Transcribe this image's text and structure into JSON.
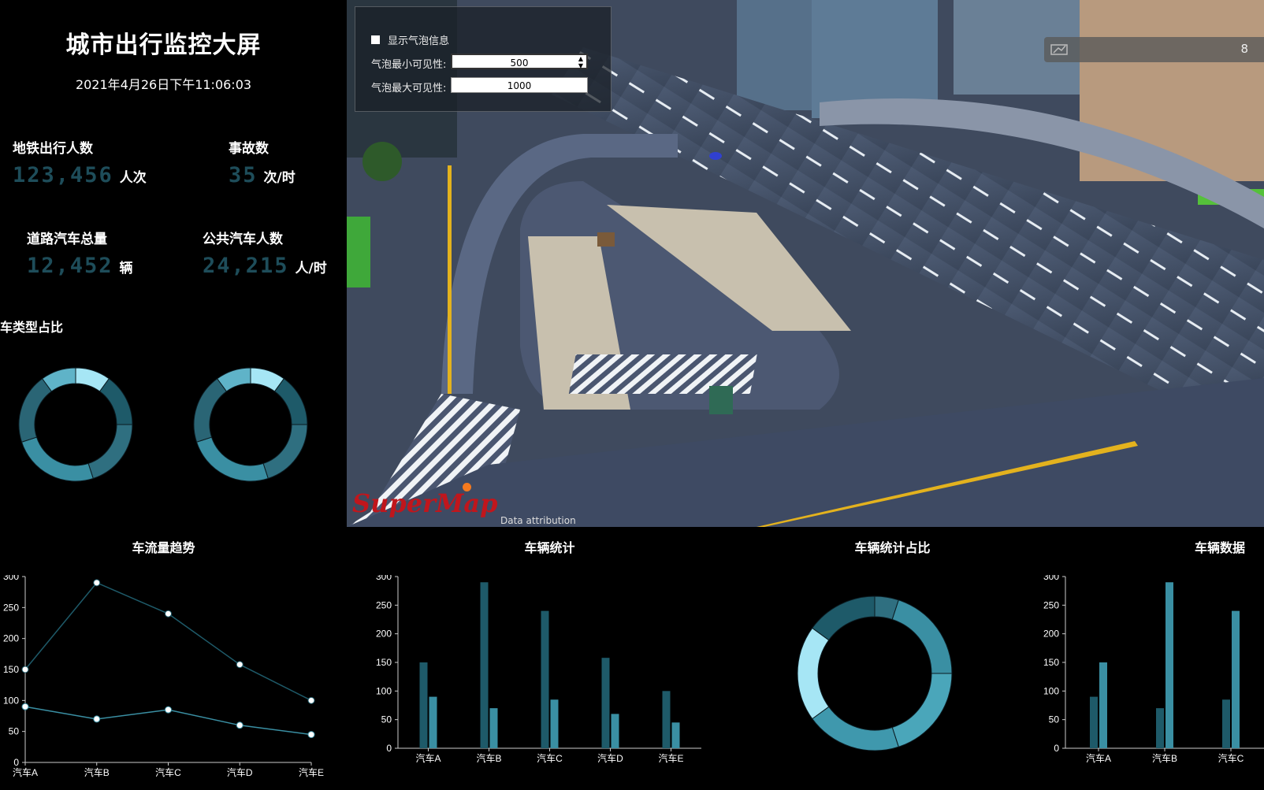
{
  "header": {
    "title": "城市出行监控大屏",
    "datetime": "2021年4月26日下午11:06:03"
  },
  "stats": {
    "subway": {
      "label": "地铁出行人数",
      "value": "123,456",
      "unit": "人次"
    },
    "accident": {
      "label": "事故数",
      "value": "35",
      "unit": "次/时"
    },
    "road": {
      "label": "道路汽车总量",
      "value": "12,452",
      "unit": "辆"
    },
    "bus": {
      "label": "公共汽车人数",
      "value": "24,215",
      "unit": "人/时"
    }
  },
  "vehicle_type": {
    "title": "汽车类型占比"
  },
  "map": {
    "bubble_panel": {
      "checkbox_label": "显示气泡信息",
      "min_label": "气泡最小可见性:",
      "min_value": "500",
      "max_label": "气泡最大可见性:",
      "max_value": "1000"
    },
    "fps_value": "8",
    "logo_text": "SuperMap",
    "attribution": "Data attribution"
  },
  "panels": {
    "trend_title": "车流量趋势",
    "stats_title": "车辆统计",
    "ratio_title": "车辆统计占比",
    "data_title": "车辆数据"
  },
  "colors": {
    "series_dark": "#1e5a69",
    "series_mid": "#3a8fa3",
    "series_light": "#a6e6f5",
    "value_text": "#1e4d5a"
  },
  "chart_data": [
    {
      "type": "line",
      "title": "车流量趋势",
      "categories": [
        "汽车A",
        "汽车B",
        "汽车C",
        "汽车D",
        "汽车E"
      ],
      "ylim": [
        0,
        300
      ],
      "yticks": [
        0,
        50,
        100,
        150,
        200,
        250,
        300
      ],
      "series": [
        {
          "values": [
            150,
            290,
            240,
            158,
            100
          ]
        },
        {
          "values": [
            90,
            70,
            85,
            60,
            45
          ]
        }
      ]
    },
    {
      "type": "bar",
      "title": "车辆统计",
      "categories": [
        "汽车A",
        "汽车B",
        "汽车C",
        "汽车D",
        "汽车E"
      ],
      "ylim": [
        0,
        300
      ],
      "yticks": [
        0,
        50,
        100,
        150,
        200,
        250,
        300
      ],
      "series": [
        {
          "values": [
            150,
            290,
            240,
            158,
            100
          ]
        },
        {
          "values": [
            90,
            70,
            85,
            60,
            45
          ]
        }
      ]
    },
    {
      "type": "pie",
      "title": "车辆统计占比",
      "values": [
        5,
        20,
        20,
        20,
        20,
        15
      ]
    },
    {
      "type": "bar",
      "title": "车辆数据",
      "categories": [
        "汽车A",
        "汽车B",
        "汽车C"
      ],
      "ylim": [
        0,
        300
      ],
      "yticks": [
        0,
        50,
        100,
        150,
        200,
        250,
        300
      ],
      "series": [
        {
          "values": [
            90,
            70,
            85
          ]
        },
        {
          "values": [
            150,
            290,
            240
          ]
        }
      ]
    },
    {
      "type": "pie",
      "title": "汽车类型占比",
      "values": [
        10,
        15,
        20,
        25,
        20,
        10
      ]
    },
    {
      "type": "pie",
      "title": "汽车类型占比",
      "values": [
        10,
        15,
        20,
        25,
        20,
        10
      ]
    }
  ]
}
